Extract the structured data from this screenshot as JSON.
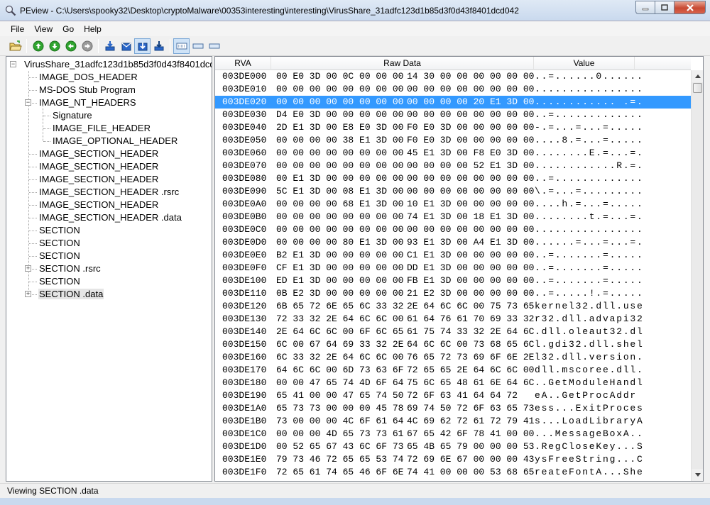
{
  "window": {
    "title": "PEview - C:\\Users\\spooky32\\Desktop\\cryptoMalware\\00353interesting\\interesting\\VirusShare_31adfc123d1b85d3f0d43f8401dcd042"
  },
  "menu": [
    "File",
    "View",
    "Go",
    "Help"
  ],
  "toolbar": {
    "buttons": [
      {
        "name": "open-file-button",
        "icon": "folder-open-icon"
      },
      {
        "name": "up-button",
        "icon": "arrow-up-icon"
      },
      {
        "name": "down-button",
        "icon": "arrow-down-icon"
      },
      {
        "name": "back-button",
        "icon": "arrow-left-icon"
      },
      {
        "name": "forward-button",
        "icon": "arrow-right-icon"
      },
      {
        "name": "view-mode-1-button",
        "icon": "download-icon"
      },
      {
        "name": "view-mode-2-button",
        "icon": "envelope-icon"
      },
      {
        "name": "view-mode-3-button",
        "icon": "download-pressed-icon"
      },
      {
        "name": "view-mode-4-button",
        "icon": "download-alt-icon"
      },
      {
        "name": "layout-1-button",
        "icon": "layout-lines-icon"
      },
      {
        "name": "layout-2-button",
        "icon": "layout-box-icon"
      },
      {
        "name": "layout-3-button",
        "icon": "layout-box-icon"
      }
    ]
  },
  "tree": [
    {
      "label": "VirusShare_31adfc123d1b85d3f0d43f8401dcd",
      "level": 0,
      "expander": "-"
    },
    {
      "label": "IMAGE_DOS_HEADER",
      "level": 1,
      "expander": ""
    },
    {
      "label": "MS-DOS Stub Program",
      "level": 1,
      "expander": ""
    },
    {
      "label": "IMAGE_NT_HEADERS",
      "level": 1,
      "expander": "-"
    },
    {
      "label": "Signature",
      "level": 2,
      "expander": ""
    },
    {
      "label": "IMAGE_FILE_HEADER",
      "level": 2,
      "expander": ""
    },
    {
      "label": "IMAGE_OPTIONAL_HEADER",
      "level": 2,
      "expander": ""
    },
    {
      "label": "IMAGE_SECTION_HEADER",
      "level": 1,
      "expander": ""
    },
    {
      "label": "IMAGE_SECTION_HEADER",
      "level": 1,
      "expander": ""
    },
    {
      "label": "IMAGE_SECTION_HEADER",
      "level": 1,
      "expander": ""
    },
    {
      "label": "IMAGE_SECTION_HEADER .rsrc",
      "level": 1,
      "expander": ""
    },
    {
      "label": "IMAGE_SECTION_HEADER",
      "level": 1,
      "expander": ""
    },
    {
      "label": "IMAGE_SECTION_HEADER .data",
      "level": 1,
      "expander": ""
    },
    {
      "label": "SECTION",
      "level": 1,
      "expander": ""
    },
    {
      "label": "SECTION",
      "level": 1,
      "expander": ""
    },
    {
      "label": "SECTION",
      "level": 1,
      "expander": ""
    },
    {
      "label": "SECTION .rsrc",
      "level": 1,
      "expander": "+"
    },
    {
      "label": "SECTION",
      "level": 1,
      "expander": ""
    },
    {
      "label": "SECTION .data",
      "level": 1,
      "expander": "+",
      "selected": true
    }
  ],
  "table": {
    "columns": [
      "RVA",
      "Raw Data",
      "Value"
    ],
    "rows": [
      {
        "rva": "003DE000",
        "hex1": "00 E0 3D 00 0C 00 00 00",
        "hex2": "14 30 00 00 00 00 00 00",
        "value": "..=......0......"
      },
      {
        "rva": "003DE010",
        "hex1": "00 00 00 00 00 00 00 00",
        "hex2": "00 00 00 00 00 00 00 00",
        "value": "................"
      },
      {
        "rva": "003DE020",
        "hex1": "00 00 00 00 00 00 00 00",
        "hex2": "00 00 00 00 20 E1 3D 00",
        "value": "............ .=.",
        "selected": true
      },
      {
        "rva": "003DE030",
        "hex1": "D4 E0 3D 00 00 00 00 00",
        "hex2": "00 00 00 00 00 00 00 00",
        "value": "..=............."
      },
      {
        "rva": "003DE040",
        "hex1": "2D E1 3D 00 E8 E0 3D 00",
        "hex2": "F0 E0 3D 00 00 00 00 00",
        "value": "-.=...=...=....."
      },
      {
        "rva": "003DE050",
        "hex1": "00 00 00 00 38 E1 3D 00",
        "hex2": "F0 E0 3D 00 00 00 00 00",
        "value": "....8.=...=....."
      },
      {
        "rva": "003DE060",
        "hex1": "00 00 00 00 00 00 00 00",
        "hex2": "45 E1 3D 00 F8 E0 3D 00",
        "value": "........E.=...=."
      },
      {
        "rva": "003DE070",
        "hex1": "00 00 00 00 00 00 00 00",
        "hex2": "00 00 00 00 52 E1 3D 00",
        "value": "............R.=."
      },
      {
        "rva": "003DE080",
        "hex1": "00 E1 3D 00 00 00 00 00",
        "hex2": "00 00 00 00 00 00 00 00",
        "value": "..=............."
      },
      {
        "rva": "003DE090",
        "hex1": "5C E1 3D 00 08 E1 3D 00",
        "hex2": "00 00 00 00 00 00 00 00",
        "value": "\\.=...=........."
      },
      {
        "rva": "003DE0A0",
        "hex1": "00 00 00 00 68 E1 3D 00",
        "hex2": "10 E1 3D 00 00 00 00 00",
        "value": "....h.=...=....."
      },
      {
        "rva": "003DE0B0",
        "hex1": "00 00 00 00 00 00 00 00",
        "hex2": "74 E1 3D 00 18 E1 3D 00",
        "value": "........t.=...=."
      },
      {
        "rva": "003DE0C0",
        "hex1": "00 00 00 00 00 00 00 00",
        "hex2": "00 00 00 00 00 00 00 00",
        "value": "................"
      },
      {
        "rva": "003DE0D0",
        "hex1": "00 00 00 00 80 E1 3D 00",
        "hex2": "93 E1 3D 00 A4 E1 3D 00",
        "value": "......=...=...=."
      },
      {
        "rva": "003DE0E0",
        "hex1": "B2 E1 3D 00 00 00 00 00",
        "hex2": "C1 E1 3D 00 00 00 00 00",
        "value": "..=.......=....."
      },
      {
        "rva": "003DE0F0",
        "hex1": "CF E1 3D 00 00 00 00 00",
        "hex2": "DD E1 3D 00 00 00 00 00",
        "value": "..=.......=....."
      },
      {
        "rva": "003DE100",
        "hex1": "ED E1 3D 00 00 00 00 00",
        "hex2": "FB E1 3D 00 00 00 00 00",
        "value": "..=.......=....."
      },
      {
        "rva": "003DE110",
        "hex1": "0B E2 3D 00 00 00 00 00",
        "hex2": "21 E2 3D 00 00 00 00 00",
        "value": "..=.....!.=....."
      },
      {
        "rva": "003DE120",
        "hex1": "6B 65 72 6E 65 6C 33 32",
        "hex2": "2E 64 6C 6C 00 75 73 65",
        "value": "kernel32.dll.use"
      },
      {
        "rva": "003DE130",
        "hex1": "72 33 32 2E 64 6C 6C 00",
        "hex2": "61 64 76 61 70 69 33 32",
        "value": "r32.dll.advapi32"
      },
      {
        "rva": "003DE140",
        "hex1": "2E 64 6C 6C 00 6F 6C 65",
        "hex2": "61 75 74 33 32 2E 64 6C",
        "value": ".dll.oleaut32.dl"
      },
      {
        "rva": "003DE150",
        "hex1": "6C 00 67 64 69 33 32 2E",
        "hex2": "64 6C 6C 00 73 68 65 6C",
        "value": "l.gdi32.dll.shel"
      },
      {
        "rva": "003DE160",
        "hex1": "6C 33 32 2E 64 6C 6C 00",
        "hex2": "76 65 72 73 69 6F 6E 2E",
        "value": "l32.dll.version."
      },
      {
        "rva": "003DE170",
        "hex1": "64 6C 6C 00 6D 73 63 6F",
        "hex2": "72 65 65 2E 64 6C 6C 00",
        "value": "dll.mscoree.dll."
      },
      {
        "rva": "003DE180",
        "hex1": "00 00 47 65 74 4D 6F 64",
        "hex2": "75 6C 65 48 61 6E 64 6C",
        "value": "..GetModuleHandl"
      },
      {
        "rva": "003DE190",
        "hex1": "65 41 00 00 47 65 74 50",
        "hex2": "72 6F 63 41 64 64 72",
        "value": "eA..GetProcAddr"
      },
      {
        "rva": "003DE1A0",
        "hex1": "65 73 73 00 00 00 45 78",
        "hex2": "69 74 50 72 6F 63 65 73",
        "value": "ess...ExitProces"
      },
      {
        "rva": "003DE1B0",
        "hex1": "73 00 00 00 4C 6F 61 64",
        "hex2": "4C 69 62 72 61 72 79 41",
        "value": "s...LoadLibraryA"
      },
      {
        "rva": "003DE1C0",
        "hex1": "00 00 00 4D 65 73 73 61",
        "hex2": "67 65 42 6F 78 41 00 00",
        "value": "...MessageBoxA.."
      },
      {
        "rva": "003DE1D0",
        "hex1": "00 52 65 67 43 6C 6F 73",
        "hex2": "65 4B 65 79 00 00 00 53",
        "value": ".RegCloseKey...S"
      },
      {
        "rva": "003DE1E0",
        "hex1": "79 73 46 72 65 65 53 74",
        "hex2": "72 69 6E 67 00 00 00 43",
        "value": "ysFreeString...C"
      },
      {
        "rva": "003DE1F0",
        "hex1": "72 65 61 74 65 46 6F 6E",
        "hex2": "74 41 00 00 00 53 68 65",
        "value": "reateFontA...She"
      }
    ]
  },
  "status": "Viewing SECTION .data",
  "colors": {
    "selection": "#3399ff",
    "tree_selection": "#e5e5e5",
    "title_gradient_top": "#dfe9f5"
  }
}
